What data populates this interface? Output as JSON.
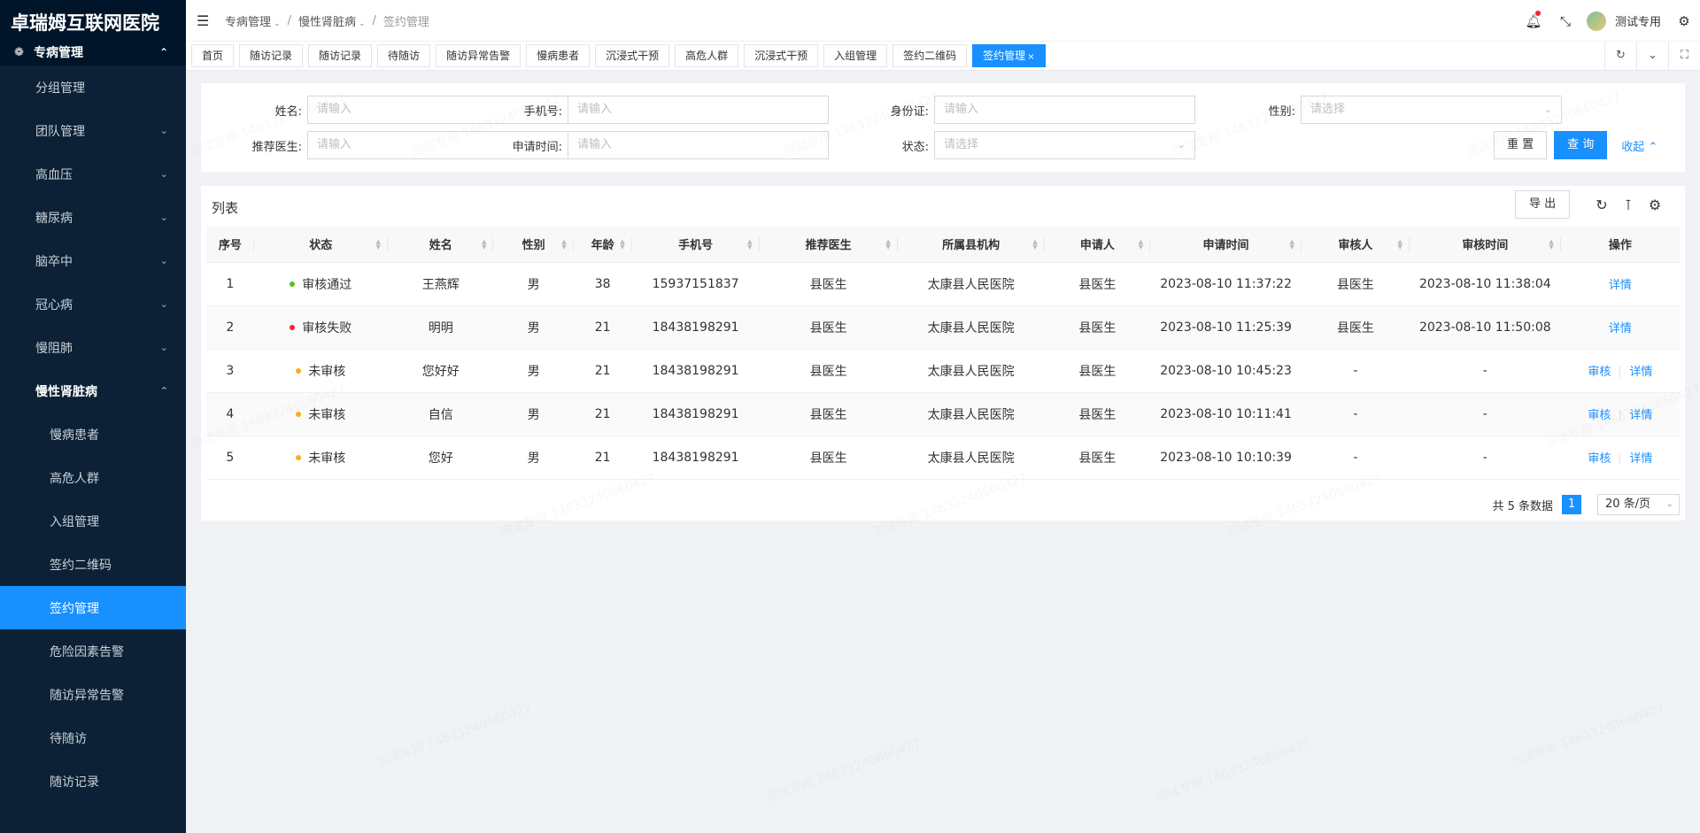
{
  "brand": "卓瑞姆互联网医院",
  "sidebar": {
    "top": {
      "icon": "grid-icon",
      "label": "专病管理"
    },
    "items": [
      {
        "label": "分组管理",
        "chev": ""
      },
      {
        "label": "团队管理",
        "chev": "⌄"
      },
      {
        "label": "高血压",
        "chev": "⌄"
      },
      {
        "label": "糖尿病",
        "chev": "⌄"
      },
      {
        "label": "脑卒中",
        "chev": "⌄"
      },
      {
        "label": "冠心病",
        "chev": "⌄"
      },
      {
        "label": "慢阻肺",
        "chev": "⌄"
      },
      {
        "label": "慢性肾脏病",
        "chev": "⌃"
      },
      {
        "label": "慢病患者",
        "chev": ""
      },
      {
        "label": "高危人群",
        "chev": ""
      },
      {
        "label": "入组管理",
        "chev": ""
      },
      {
        "label": "签约二维码",
        "chev": ""
      },
      {
        "label": "签约管理",
        "chev": ""
      },
      {
        "label": "危险因素告警",
        "chev": ""
      },
      {
        "label": "随访异常告警",
        "chev": ""
      },
      {
        "label": "待随访",
        "chev": ""
      },
      {
        "label": "随访记录",
        "chev": ""
      }
    ]
  },
  "header": {
    "breadcrumb": [
      "专病管理",
      "慢性肾脏病",
      "签约管理"
    ],
    "username": "测试专用"
  },
  "tabs": [
    "首页",
    "随访记录",
    "随访记录",
    "待随访",
    "随访异常告警",
    "慢病患者",
    "沉浸式干预",
    "高危人群",
    "沉浸式干预",
    "入组管理",
    "签约二维码",
    "签约管理"
  ],
  "filter": {
    "fields": [
      {
        "label": "姓名:",
        "placeholder": "请输入"
      },
      {
        "label": "手机号:",
        "placeholder": "请输入"
      },
      {
        "label": "身份证:",
        "placeholder": "请输入"
      },
      {
        "label": "性别:",
        "placeholder": "请选择"
      },
      {
        "label": "推荐医生:",
        "placeholder": "请输入"
      },
      {
        "label": "申请时间:",
        "placeholder": "请输入"
      },
      {
        "label": "状态:",
        "placeholder": "请选择"
      }
    ],
    "reset": "重 置",
    "query": "查 询",
    "collapse": "收起"
  },
  "list": {
    "title": "列表",
    "export": "导 出",
    "columns": [
      "序号",
      "状态",
      "姓名",
      "性别",
      "年龄",
      "手机号",
      "推荐医生",
      "所属县机构",
      "申请人",
      "申请时间",
      "审核人",
      "审核时间",
      "操作"
    ],
    "rows": [
      {
        "no": "1",
        "status": "审核通过",
        "status_color": "#52c41a",
        "name": "王燕辉",
        "gender": "男",
        "age": "38",
        "phone": "15937151837",
        "doctor": "县医生",
        "org": "太康县人民医院",
        "applicant": "县医生",
        "apply_time": "2023-08-10 11:37:22",
        "reviewer": "县医生",
        "review_time": "2023-08-10 11:38:04",
        "ops": [
          "详情"
        ]
      },
      {
        "no": "2",
        "status": "审核失败",
        "status_color": "#f5222d",
        "name": "明明",
        "gender": "男",
        "age": "21",
        "phone": "18438198291",
        "doctor": "县医生",
        "org": "太康县人民医院",
        "applicant": "县医生",
        "apply_time": "2023-08-10 11:25:39",
        "reviewer": "县医生",
        "review_time": "2023-08-10 11:50:08",
        "ops": [
          "详情"
        ]
      },
      {
        "no": "3",
        "status": "未审核",
        "status_color": "#faad14",
        "name": "您好好",
        "gender": "男",
        "age": "21",
        "phone": "18438198291",
        "doctor": "县医生",
        "org": "太康县人民医院",
        "applicant": "县医生",
        "apply_time": "2023-08-10 10:45:23",
        "reviewer": "-",
        "review_time": "-",
        "ops": [
          "审核",
          "详情"
        ]
      },
      {
        "no": "4",
        "status": "未审核",
        "status_color": "#faad14",
        "name": "自信",
        "gender": "男",
        "age": "21",
        "phone": "18438198291",
        "doctor": "县医生",
        "org": "太康县人民医院",
        "applicant": "县医生",
        "apply_time": "2023-08-10 10:11:41",
        "reviewer": "-",
        "review_time": "-",
        "ops": [
          "审核",
          "详情"
        ]
      },
      {
        "no": "5",
        "status": "未审核",
        "status_color": "#faad14",
        "name": "您好",
        "gender": "男",
        "age": "21",
        "phone": "18438198291",
        "doctor": "县医生",
        "org": "太康县人民医院",
        "applicant": "县医生",
        "apply_time": "2023-08-10 10:10:39",
        "reviewer": "-",
        "review_time": "-",
        "ops": [
          "审核",
          "详情"
        ]
      }
    ]
  },
  "pagination": {
    "total_text": "共 5 条数据",
    "current": "1",
    "page_size": "20 条/页"
  },
  "watermark": "测试专用 14633240660427"
}
